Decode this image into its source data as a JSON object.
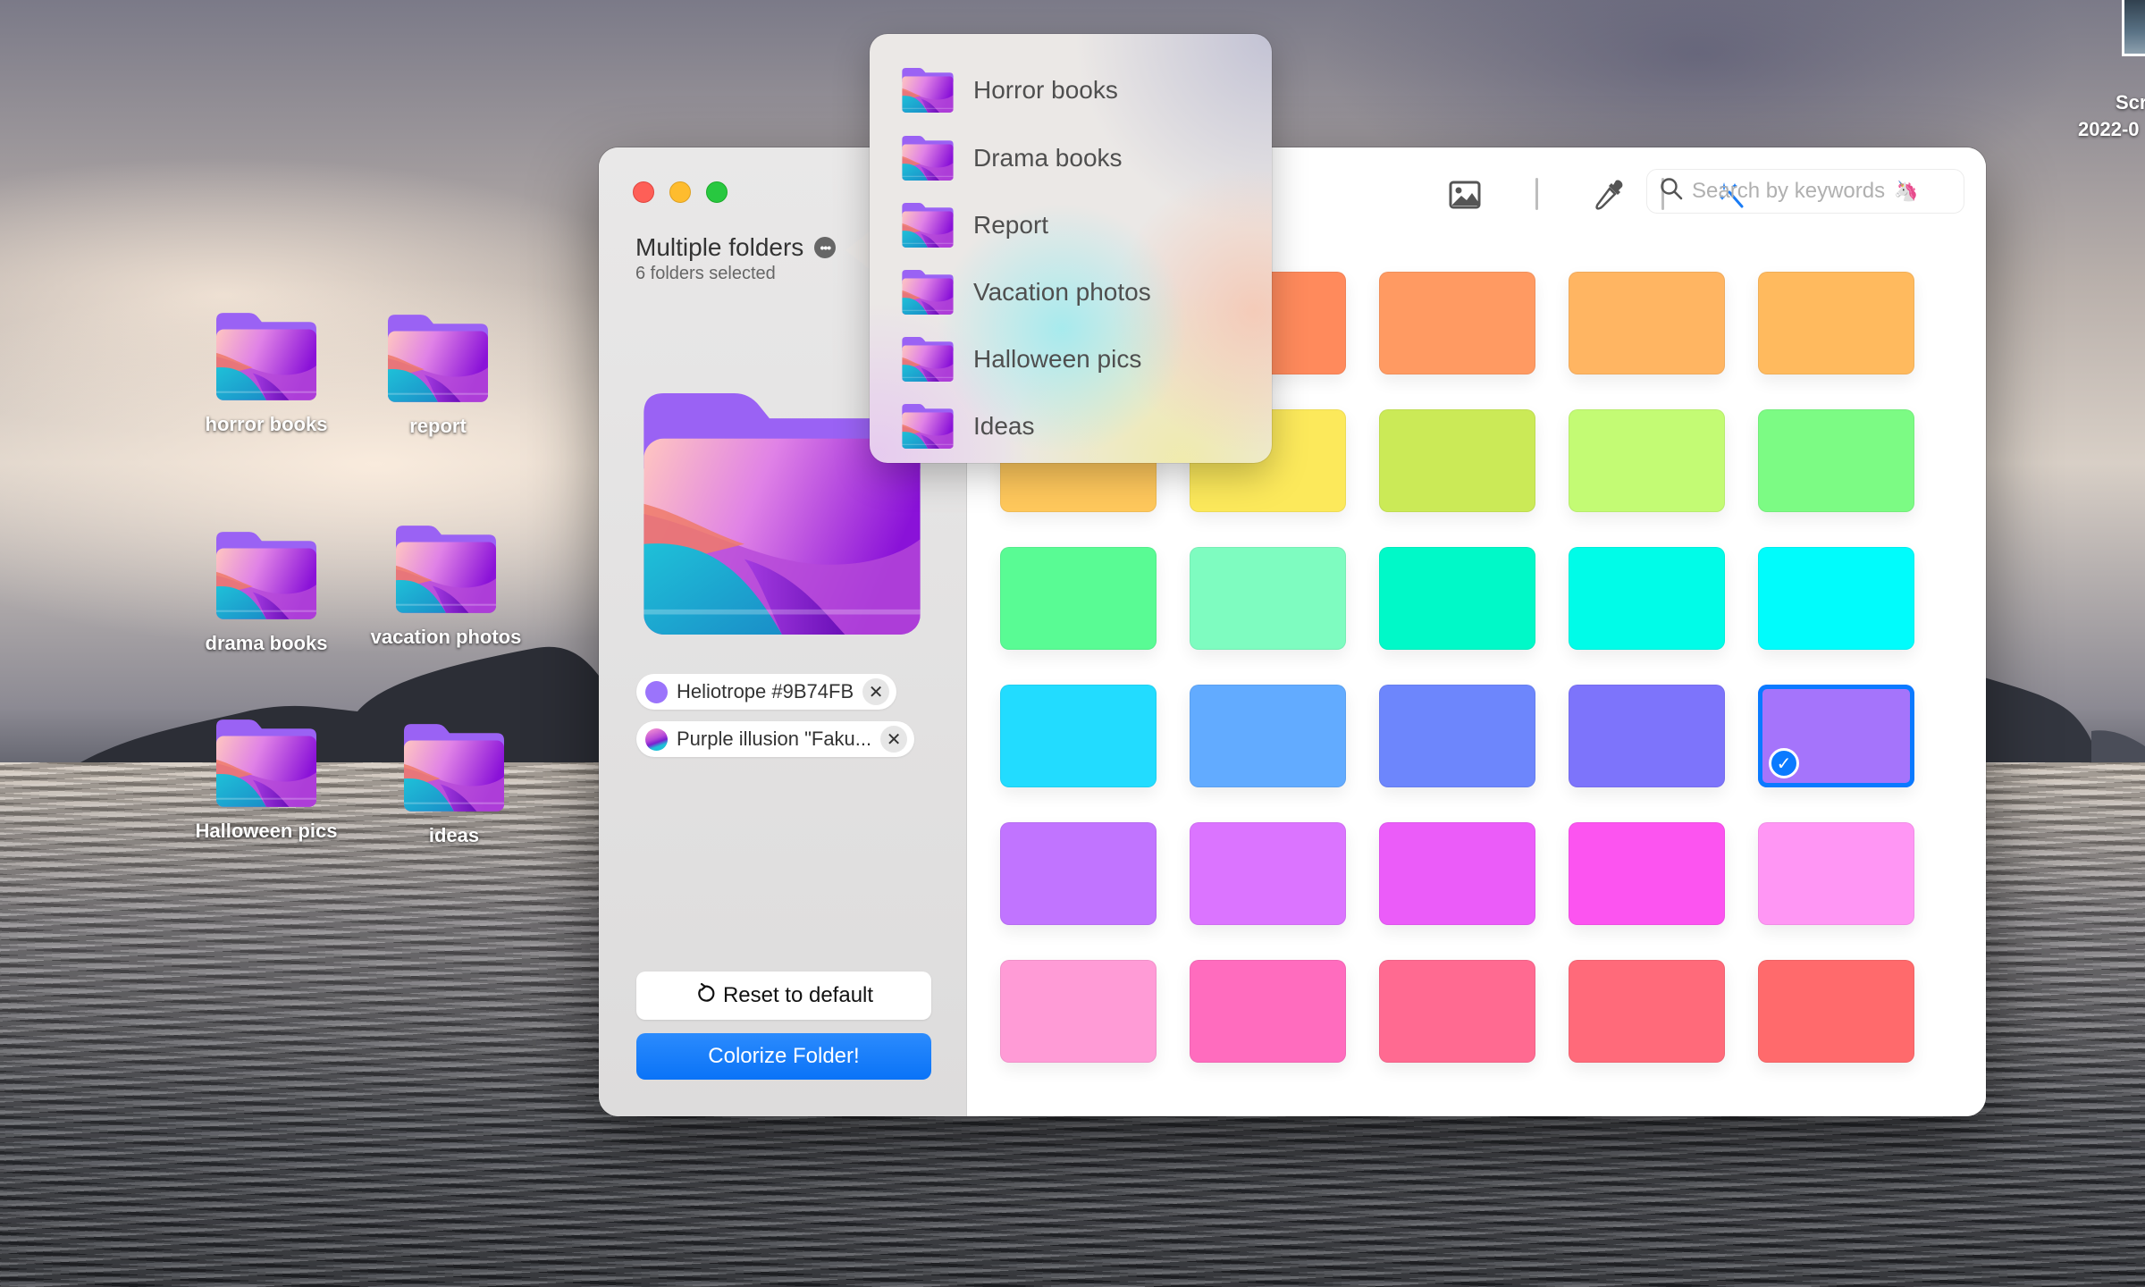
{
  "desktop": {
    "icons": [
      {
        "label": "horror books"
      },
      {
        "label": "report"
      },
      {
        "label": "drama books"
      },
      {
        "label": "vacation photos"
      },
      {
        "label": "Halloween pics"
      },
      {
        "label": "ideas"
      }
    ],
    "screenshot_file": {
      "label_line1": "Scr",
      "label_line2": "2022-0"
    }
  },
  "window": {
    "traffic_lights": [
      "close",
      "minimize",
      "zoom"
    ],
    "sidebar": {
      "title": "Multiple folders",
      "subtitle": "6 folders selected",
      "more_icon": "ellipsis-circle-icon",
      "chips": [
        {
          "label": "Heliotrope #9B74FB",
          "color": "#9B74FB",
          "type": "solid"
        },
        {
          "label": "Purple illusion \"Faku...",
          "type": "gradient"
        }
      ],
      "reset_label": "Reset to default",
      "colorize_label": "Colorize Folder!"
    },
    "toolbar": {
      "tools": [
        "image-icon",
        "eyedropper-icon",
        "magic-wand-icon"
      ],
      "active_tool": "magic-wand-icon",
      "search_placeholder": "Search by keywords",
      "search_emoji": "unicorn"
    },
    "swatches": [
      [
        "#FF8A5C",
        "#FF8A5C",
        "#FF9A62",
        "#FFB562",
        "#FFBA5E"
      ],
      [
        "#FFC85C",
        "#FCE95B",
        "#CBEA57",
        "#C3FB74",
        "#7CFB84"
      ],
      [
        "#59FB94",
        "#7EFCC0",
        "#00F9C8",
        "#00FCE8",
        "#00FCFC"
      ],
      [
        "#22DCFF",
        "#62ABFF",
        "#6D86FC",
        "#7D74FB",
        "#A574FB"
      ],
      [
        "#C174FF",
        "#DB74FF",
        "#EB5CF9",
        "#FC54F0",
        "#FF96F4"
      ],
      [
        "#FF9BD6",
        "#FF6CBE",
        "#FF6A91",
        "#FF6A7A",
        "#FF6A6C"
      ]
    ],
    "selected_swatch": {
      "row": 3,
      "col": 4
    },
    "accent_color": "#0A7AFF"
  },
  "popover": {
    "items": [
      {
        "label": "Horror books"
      },
      {
        "label": "Drama books"
      },
      {
        "label": "Report"
      },
      {
        "label": "Vacation photos"
      },
      {
        "label": "Halloween pics"
      },
      {
        "label": "Ideas"
      }
    ]
  }
}
